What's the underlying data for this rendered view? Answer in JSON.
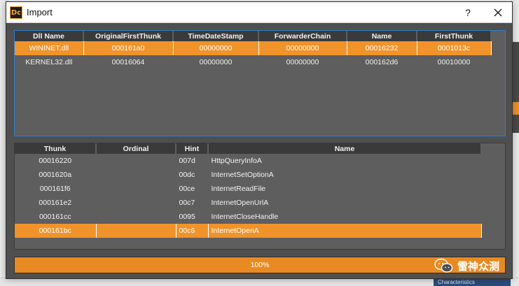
{
  "dialog": {
    "icon_label": "Dc",
    "title": "Import",
    "help_label": "?"
  },
  "dll_table": {
    "columns": [
      "Dll Name",
      "OriginalFirstThunk",
      "TimeDateStamp",
      "ForwarderChain",
      "Name",
      "FirstThunk"
    ],
    "rows": [
      [
        "WININET.dll",
        "000161a0",
        "00000000",
        "00000000",
        "00016232",
        "0001013c"
      ],
      [
        "KERNEL32.dll",
        "00016064",
        "00000000",
        "00000000",
        "000162d6",
        "00010000"
      ]
    ],
    "selected_row": 0
  },
  "func_table": {
    "columns": [
      "Thunk",
      "Ordinal",
      "Hint",
      "Name"
    ],
    "rows": [
      [
        "00016220",
        "",
        "007d",
        "HttpQueryInfoA"
      ],
      [
        "0001620a",
        "",
        "00dc",
        "InternetSetOptionA"
      ],
      [
        "000161f6",
        "",
        "00ce",
        "InternetReadFile"
      ],
      [
        "000161e2",
        "",
        "00c7",
        "InternetOpenUrlA"
      ],
      [
        "000161cc",
        "",
        "0095",
        "InternetCloseHandle"
      ],
      [
        "000161bc",
        "",
        "00c6",
        "InternetOpenA"
      ]
    ],
    "selected_row": 5
  },
  "progress": {
    "value": 1.0,
    "label": "100%"
  },
  "watermark": {
    "text": "雷神众测",
    "icon": "wechat-icon"
  },
  "background": {
    "status_tag": "Characteristics"
  },
  "colors": {
    "accent": "#f0932a",
    "panel": "#5e5e5e",
    "header": "#3a3a3a",
    "focus_border": "#2d7fd0"
  }
}
